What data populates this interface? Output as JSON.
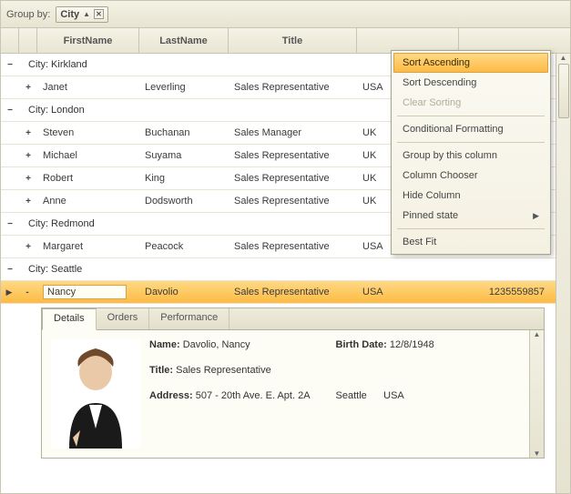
{
  "groupbar": {
    "label": "Group by:",
    "chip": {
      "field": "City",
      "sort": "asc"
    }
  },
  "columns": {
    "firstName": "FirstName",
    "lastName": "LastName",
    "title": "Title",
    "country": "",
    "phone": ""
  },
  "groups": [
    {
      "expanded": true,
      "label": "City: Kirkland",
      "rows": [
        {
          "expand": "+",
          "firstName": "Janet",
          "lastName": "Leverling",
          "title": "Sales Representative",
          "country": "USA",
          "phone": ""
        }
      ]
    },
    {
      "expanded": true,
      "label": "City: London",
      "rows": [
        {
          "expand": "+",
          "firstName": "Steven",
          "lastName": "Buchanan",
          "title": "Sales Manager",
          "country": "UK",
          "phone": ""
        },
        {
          "expand": "+",
          "firstName": "Michael",
          "lastName": "Suyama",
          "title": "Sales Representative",
          "country": "UK",
          "phone": ""
        },
        {
          "expand": "+",
          "firstName": "Robert",
          "lastName": "King",
          "title": "Sales Representative",
          "country": "UK",
          "phone": ""
        },
        {
          "expand": "+",
          "firstName": "Anne",
          "lastName": "Dodsworth",
          "title": "Sales Representative",
          "country": "UK",
          "phone": ""
        }
      ]
    },
    {
      "expanded": true,
      "label": "City: Redmond",
      "rows": [
        {
          "expand": "+",
          "firstName": "Margaret",
          "lastName": "Peacock",
          "title": "Sales Representative",
          "country": "USA",
          "phone": ""
        }
      ]
    },
    {
      "expanded": true,
      "label": "City: Seattle",
      "rows": [
        {
          "expand": "-",
          "firstName": "Nancy",
          "lastName": "Davolio",
          "title": "Sales Representative",
          "country": "USA",
          "phone": "1235559857",
          "selected": true
        }
      ]
    }
  ],
  "detail": {
    "tabs": {
      "t1": "Details",
      "t2": "Orders",
      "t3": "Performance"
    },
    "nameLabel": "Name:",
    "nameValue": "Davolio, Nancy",
    "birthLabel": "Birth Date:",
    "birthValue": "12/8/1948",
    "titleLabel": "Title:",
    "titleValue": "Sales Representative",
    "addressLabel": "Address:",
    "addressValue": "507 - 20th Ave. E. Apt. 2A",
    "city": "Seattle",
    "country": "USA"
  },
  "contextMenu": {
    "sortAsc": "Sort Ascending",
    "sortDesc": "Sort Descending",
    "clearSort": "Clear Sorting",
    "condFmt": "Conditional Formatting",
    "groupBy": "Group by this column",
    "colChooser": "Column Chooser",
    "hideCol": "Hide Column",
    "pinned": "Pinned state",
    "bestFit": "Best Fit"
  }
}
